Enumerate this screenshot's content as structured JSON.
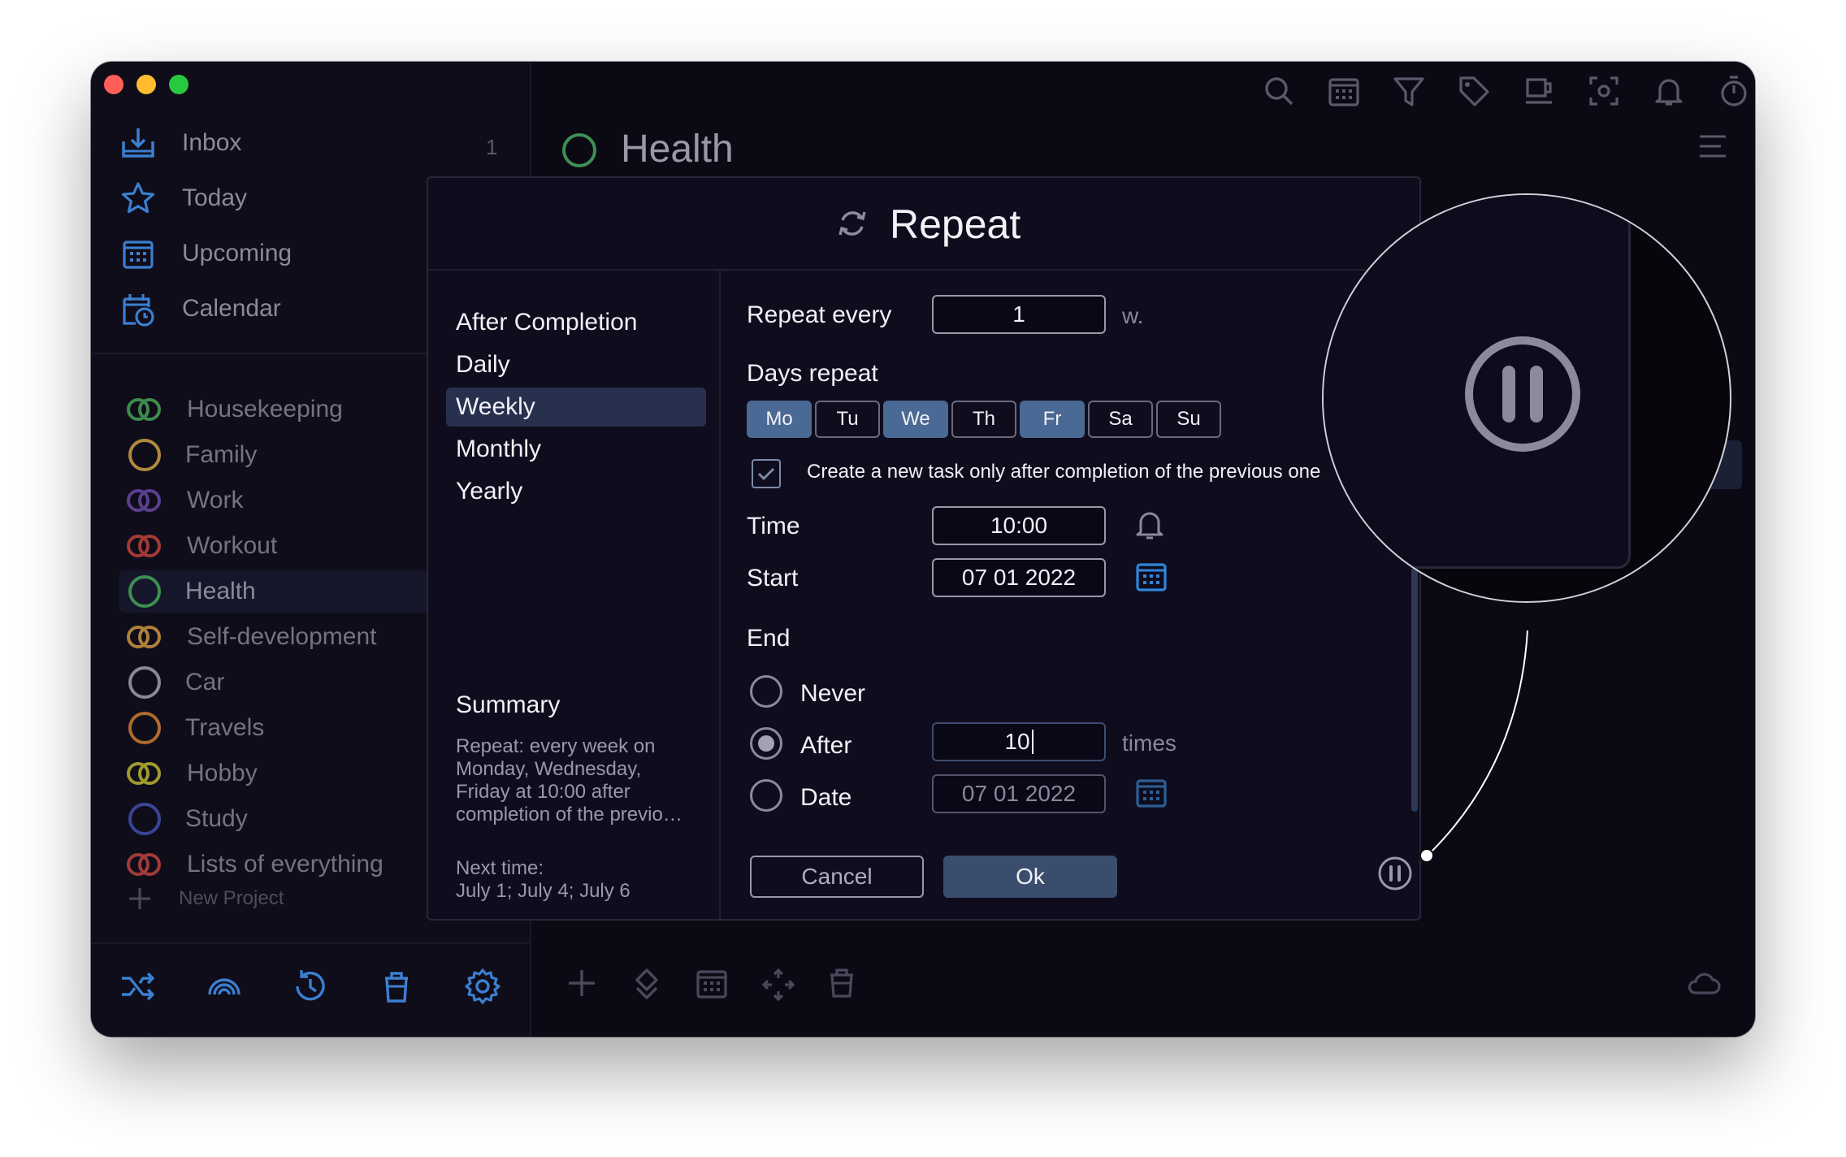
{
  "window": {
    "traffic_lights": {
      "close": "#ff5f57",
      "minimize": "#febc2e",
      "zoom": "#28c840"
    }
  },
  "sidebar": {
    "nav": [
      {
        "label": "Inbox",
        "icon": "inbox-icon",
        "count": "1"
      },
      {
        "label": "Today",
        "icon": "star-icon"
      },
      {
        "label": "Upcoming",
        "icon": "calendar-grid-icon"
      },
      {
        "label": "Calendar",
        "icon": "calendar-clock-icon"
      }
    ],
    "projects": [
      {
        "label": "Housekeeping",
        "color": "#3e8a4e",
        "icon": "double-ring-icon"
      },
      {
        "label": "Family",
        "color": "#b08a3c",
        "icon": "ring-icon"
      },
      {
        "label": "Work",
        "color": "#5a3f8f",
        "icon": "double-ring-icon"
      },
      {
        "label": "Workout",
        "color": "#a33a34",
        "icon": "double-ring-icon"
      },
      {
        "label": "Health",
        "color": "#3c8f53",
        "icon": "ring-icon",
        "selected": true
      },
      {
        "label": "Self-development",
        "color": "#b0803a",
        "icon": "double-ring-icon"
      },
      {
        "label": "Car",
        "color": "#8a8898",
        "icon": "ring-icon"
      },
      {
        "label": "Travels",
        "color": "#b06a2e",
        "icon": "ring-icon"
      },
      {
        "label": "Hobby",
        "color": "#a09a2e",
        "icon": "double-ring-icon"
      },
      {
        "label": "Study",
        "color": "#3a4596",
        "icon": "ring-icon"
      },
      {
        "label": "Lists of everything",
        "color": "#a33a3a",
        "icon": "double-ring-icon"
      }
    ],
    "new_project": "New Project",
    "bottom_icons": [
      "shuffle-icon",
      "rainbow-icon",
      "history-icon",
      "trash-icon",
      "settings-icon"
    ]
  },
  "main": {
    "title": "Health",
    "toolbar_icons": [
      "search-icon",
      "calendar-grid-icon",
      "filter-icon",
      "tag-icon",
      "mug-icon",
      "focus-icon",
      "bell-icon",
      "timer-icon",
      "copy-icon"
    ],
    "bottom_icons": [
      "add-icon",
      "priority-icon",
      "calendar-grid-icon",
      "move-icon",
      "trash-icon",
      "cloud-icon"
    ]
  },
  "dialog": {
    "title": "Repeat",
    "options": [
      "After Completion",
      "Daily",
      "Weekly",
      "Monthly",
      "Yearly"
    ],
    "selected_option": "Weekly",
    "summary_title": "Summary",
    "summary_text": "Repeat: every week on Monday, Wednesday, Friday at 10:00 after completion of the previo…",
    "next_time_label": "Next time:",
    "next_time": "July 1; July 4; July 6",
    "repeat_every_label": "Repeat every",
    "repeat_every_value": "1",
    "repeat_every_unit": "w.",
    "days_label": "Days repeat",
    "days": [
      {
        "label": "Mo",
        "on": true
      },
      {
        "label": "Tu",
        "on": false
      },
      {
        "label": "We",
        "on": true
      },
      {
        "label": "Th",
        "on": false
      },
      {
        "label": "Fr",
        "on": true
      },
      {
        "label": "Sa",
        "on": false
      },
      {
        "label": "Su",
        "on": false
      }
    ],
    "checkbox_label": "Create a new task only after completion of the previous one",
    "checkbox_checked": true,
    "time_label": "Time",
    "time_value": "10:00",
    "start_label": "Start",
    "start_value": "07 01 2022",
    "end_label": "End",
    "end_options": [
      {
        "label": "Never",
        "selected": false
      },
      {
        "label": "After",
        "selected": true
      },
      {
        "label": "Date",
        "selected": false
      }
    ],
    "after_value": "10",
    "after_unit": "times",
    "date_value": "07 01 2022",
    "cancel": "Cancel",
    "ok": "Ok"
  },
  "colors": {
    "accent": "#4a6994",
    "selected_bg": "#27304d",
    "window_bg": "#0c0a16"
  }
}
